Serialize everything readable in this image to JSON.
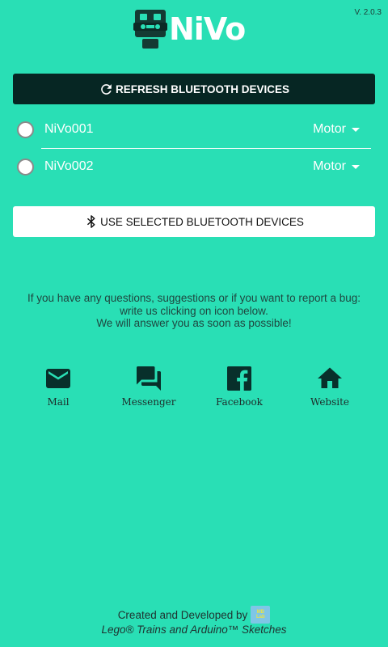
{
  "header": {
    "version": "V. 2.0.3",
    "app_name": "NiVo"
  },
  "refresh_button": {
    "label": "REFRESH BLUETOOTH DEVICES",
    "icon": "refresh-icon"
  },
  "devices": [
    {
      "name": "NiVo001",
      "type": "Motor",
      "selected": false
    },
    {
      "name": "NiVo002",
      "type": "Motor",
      "selected": false
    }
  ],
  "use_button": {
    "label": "USE SELECTED BLUETOOTH DEVICES",
    "icon": "bluetooth-icon"
  },
  "info": {
    "line1": "If you have any questions, suggestions or if you want to report a bug:",
    "line2": "write us clicking on icon below.",
    "line3": "We will answer you as soon as possible!"
  },
  "contacts": [
    {
      "label": "Mail",
      "icon": "mail-icon"
    },
    {
      "label": "Messenger",
      "icon": "messenger-icon"
    },
    {
      "label": "Facebook",
      "icon": "facebook-icon"
    },
    {
      "label": "Website",
      "icon": "home-icon"
    }
  ],
  "footer": {
    "line1": "Created and Developed by",
    "badge_top": "MB",
    "badge_bottom": "Lab",
    "line2": "Lego® Trains and Arduino™ Sketches"
  },
  "colors": {
    "background": "#29dfb5",
    "refresh_button_bg": "#062623",
    "icon_dark": "#08302b",
    "text_white": "#ffffff"
  }
}
